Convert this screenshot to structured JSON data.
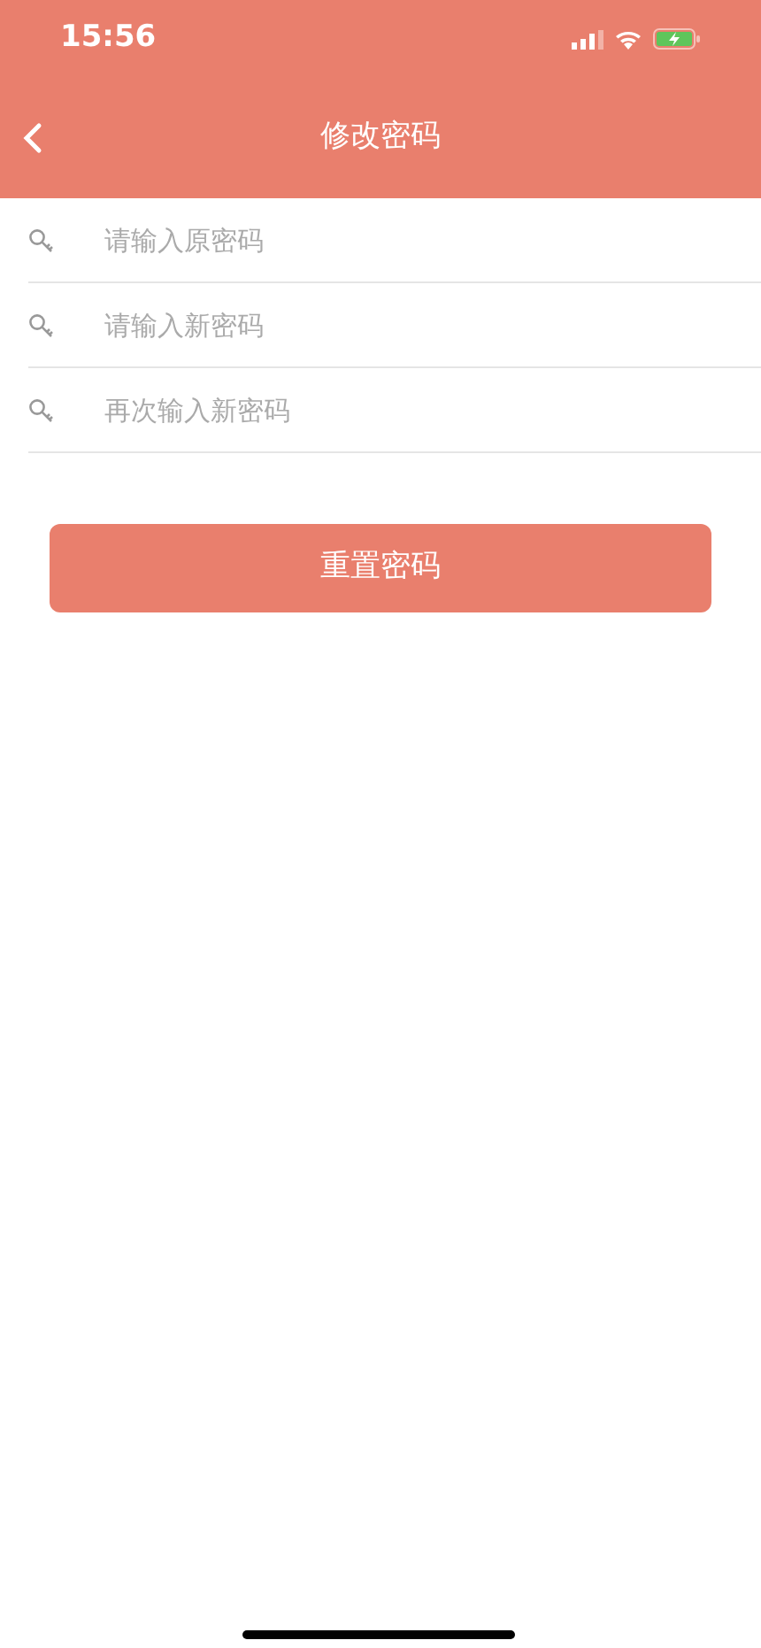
{
  "status_bar": {
    "time": "15:56"
  },
  "nav": {
    "title": "修改密码"
  },
  "fields": [
    {
      "placeholder": "请输入原密码"
    },
    {
      "placeholder": "请输入新密码"
    },
    {
      "placeholder": "再次输入新密码"
    }
  ],
  "button": {
    "label": "重置密码"
  }
}
